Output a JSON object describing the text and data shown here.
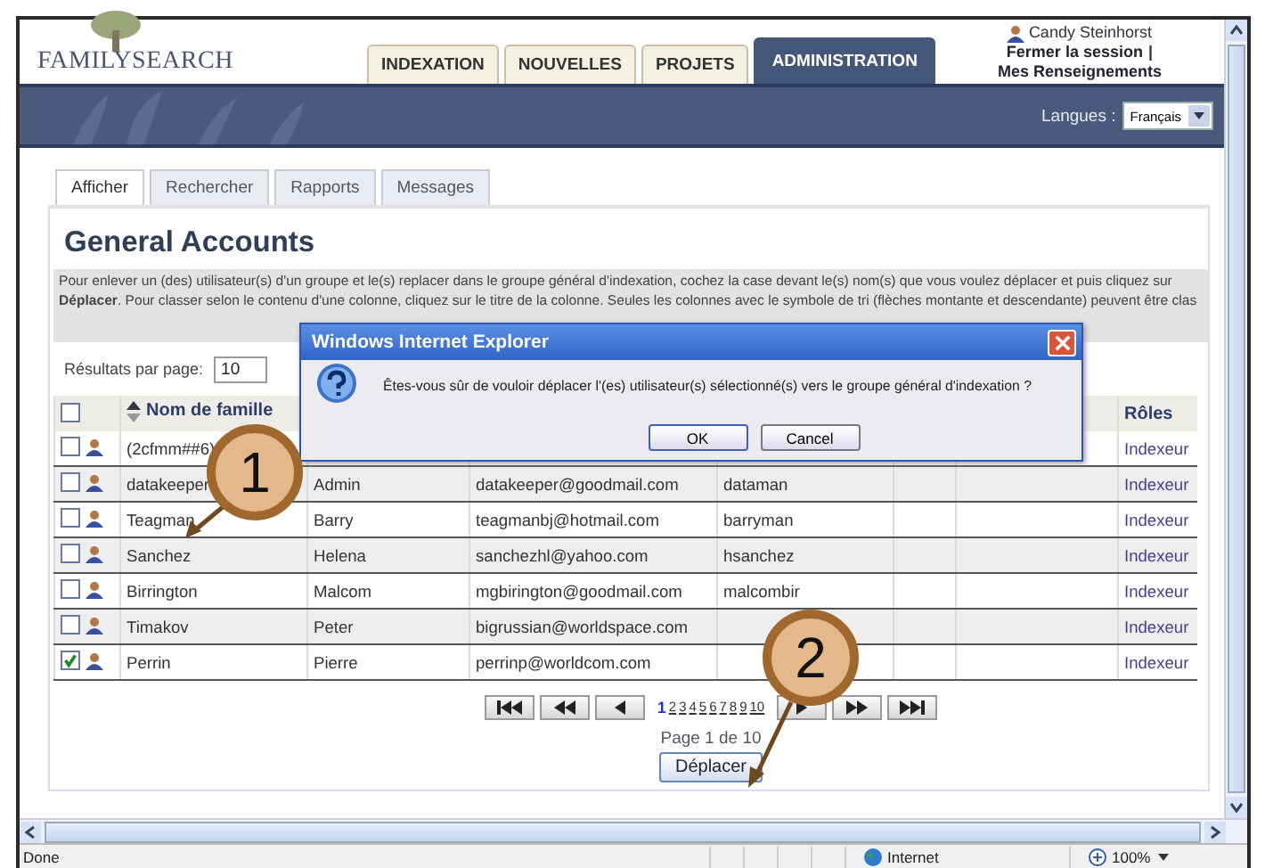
{
  "header": {
    "logo": "FAMILYSEARCH",
    "tabs": [
      {
        "label": "INDEXATION",
        "selected": false
      },
      {
        "label": "NOUVELLES",
        "selected": false
      },
      {
        "label": "PROJETS",
        "selected": false
      },
      {
        "label": "ADMINISTRATION",
        "selected": true
      }
    ],
    "user": "Candy Steinhorst",
    "logout": "Fermer la session",
    "separator": "|",
    "profile": "Mes Renseignements"
  },
  "language_bar": {
    "label": "Langues :",
    "value": "Français"
  },
  "subtabs": [
    {
      "label": "Afficher",
      "selected": true
    },
    {
      "label": "Rechercher",
      "selected": false
    },
    {
      "label": "Rapports",
      "selected": false
    },
    {
      "label": "Messages",
      "selected": false
    }
  ],
  "panel": {
    "title": "General Accounts",
    "description": "Pour enlever un (des) utilisateur(s) d'un groupe et le(s) replacer dans le groupe général d'indexation, cochez la case devant le(s) nom(s) que vous voulez déplacer et puis cliquez sur **Déplacer**. Pour classer selon le contenu d'une colonne, cliquez sur le titre de la colonne. Seules les colonnes avec le symbole de tri (flèches montante et descendante) peuvent être clas",
    "page_size_label": "Résultats par page:",
    "page_size": "10",
    "table": {
      "all_checked": false,
      "name_header": "Nom de famille",
      "role_header": "Rôles",
      "rows": [
        {
          "checked": false,
          "last": "(2cfmm##6)",
          "role": "Indexeur"
        },
        {
          "checked": false,
          "last": "datakeeper",
          "first": "Admin",
          "email": "datakeeper@goodmail.com",
          "user": "dataman",
          "role": "Indexeur"
        },
        {
          "checked": false,
          "last": "Teagman",
          "first": "Barry",
          "email": "teagmanbj@hotmail.com",
          "user": "barryman",
          "role": "Indexeur"
        },
        {
          "checked": false,
          "last": "Sanchez",
          "first": "Helena",
          "email": "sanchezhl@yahoo.com",
          "user": "hsanchez",
          "role": "Indexeur"
        },
        {
          "checked": false,
          "last": "Birrington",
          "first": "Malcom",
          "email": "mgbirington@goodmail.com",
          "user": "malcombir",
          "role": "Indexeur"
        },
        {
          "checked": false,
          "last": "Timakov",
          "first": "Peter",
          "email": "bigrussian@worldspace.com",
          "role": "Indexeur"
        },
        {
          "checked": true,
          "last": "Perrin",
          "first": "Pierre",
          "email": "perrinp@worldcom.com",
          "role": "Indexeur"
        }
      ]
    },
    "pages": [
      {
        "label": "1",
        "selected": true
      },
      {
        "label": "2",
        "selected": false
      },
      {
        "label": "3",
        "selected": false
      },
      {
        "label": "4",
        "selected": false
      },
      {
        "label": "5",
        "selected": false
      },
      {
        "label": "6",
        "selected": false
      },
      {
        "label": "7",
        "selected": false
      },
      {
        "label": "8",
        "selected": false
      },
      {
        "label": "9",
        "selected": false
      },
      {
        "label": "10",
        "selected": false
      }
    ],
    "page_info": "Page 1 de 10",
    "move_button": "Déplacer"
  },
  "dialog": {
    "title": "Windows Internet Explorer",
    "message": "Êtes-vous sûr de vouloir déplacer l'(es) utilisateur(s) sélectionné(s) vers le groupe général d'indexation ?",
    "buttons": [
      "OK",
      "Cancel"
    ]
  },
  "callouts": [
    {
      "number": "1"
    },
    {
      "number": "2"
    }
  ],
  "status_bar": {
    "status": "Done",
    "zone": "Internet",
    "zoom": "100%"
  }
}
